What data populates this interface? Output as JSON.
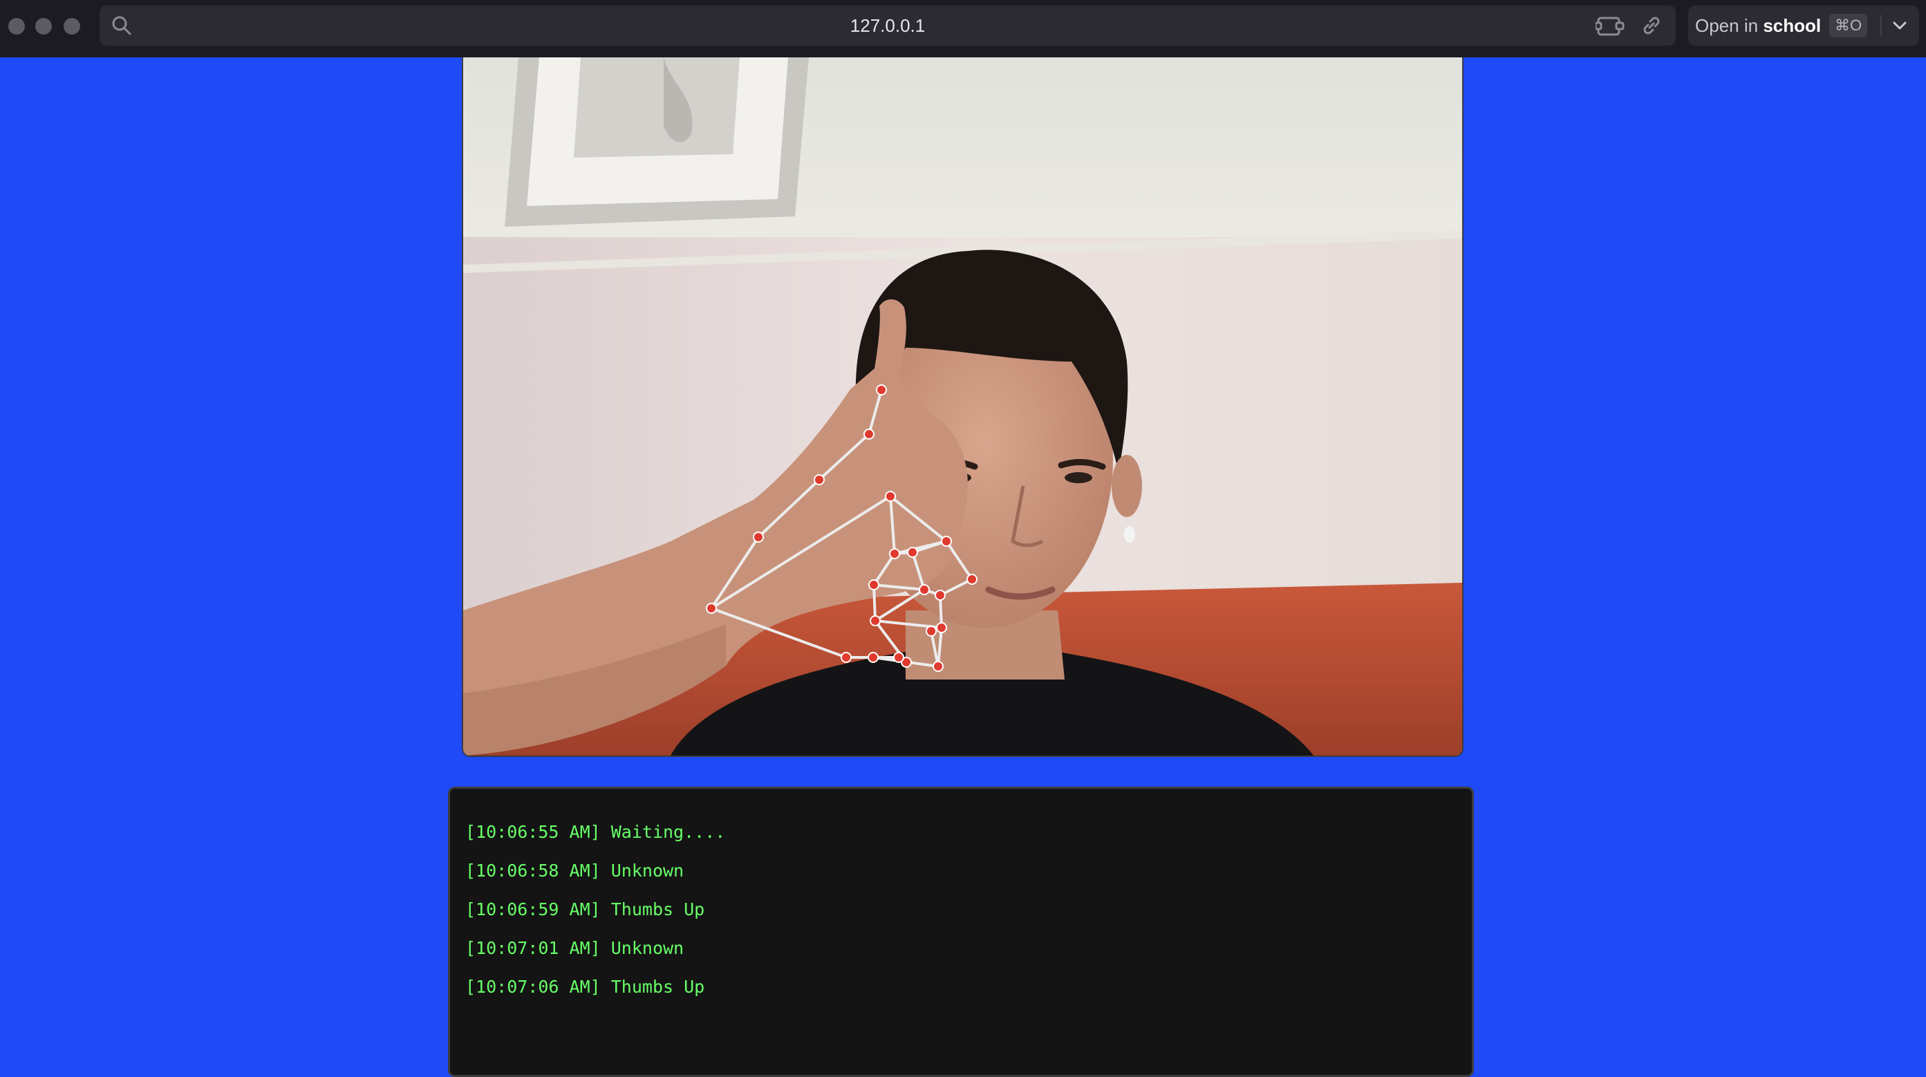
{
  "browser": {
    "url": "127.0.0.1",
    "open_in_prefix": "Open in",
    "open_in_target": "school",
    "open_in_shortcut": "⌘O"
  },
  "icons": {
    "window_controls": [
      "close-dot",
      "minimize-dot",
      "zoom-dot"
    ],
    "url_bar": [
      "search-icon"
    ],
    "toolbar": [
      "extension-icon",
      "link-icon",
      "chevron-down-icon"
    ]
  },
  "colors": {
    "page_background": "#1f4af5",
    "log_text": "#67ff67",
    "log_background": "#141414",
    "landmark_point": "#e03a2e",
    "landmark_line": "#ececec"
  },
  "log": {
    "entries": [
      {
        "time": "[10:06:55 AM]",
        "message": "Waiting...."
      },
      {
        "time": "[10:06:58 AM]",
        "message": "Unknown"
      },
      {
        "time": "[10:06:59 AM]",
        "message": "Thumbs Up"
      },
      {
        "time": "[10:07:01 AM]",
        "message": "Unknown"
      },
      {
        "time": "[10:07:06 AM]",
        "message": "Thumbs Up"
      }
    ]
  }
}
